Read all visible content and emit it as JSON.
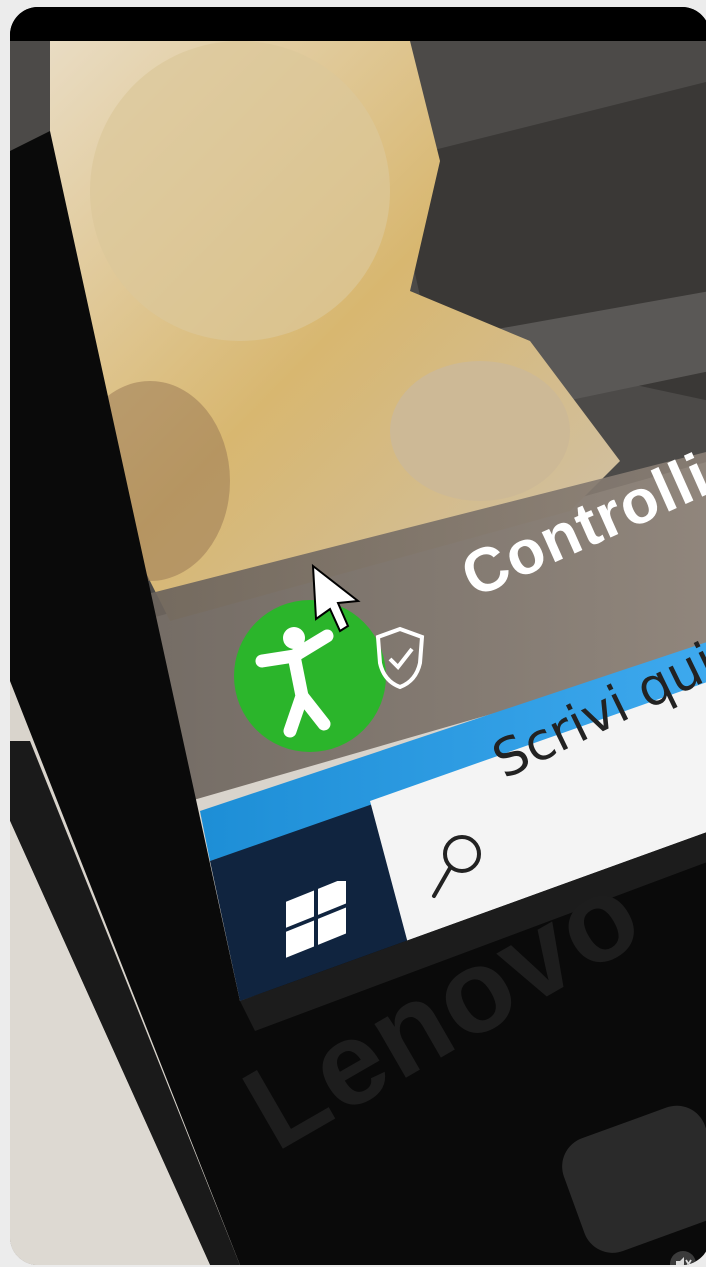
{
  "banner": {
    "title": "Controlli d"
  },
  "taskbar": {
    "search_placeholder": "Scrivi qui per",
    "start_icon": "windows-logo-icon",
    "search_icon": "search-icon"
  },
  "notification": {
    "app_icon": "accessibility-person-icon",
    "shield_icon": "shield-check-icon",
    "app_icon_color": "#2bb52b"
  },
  "device": {
    "brand": "Lenovo"
  },
  "cursor": "mouse-pointer-icon",
  "mute_icon": "speaker-muted-icon"
}
